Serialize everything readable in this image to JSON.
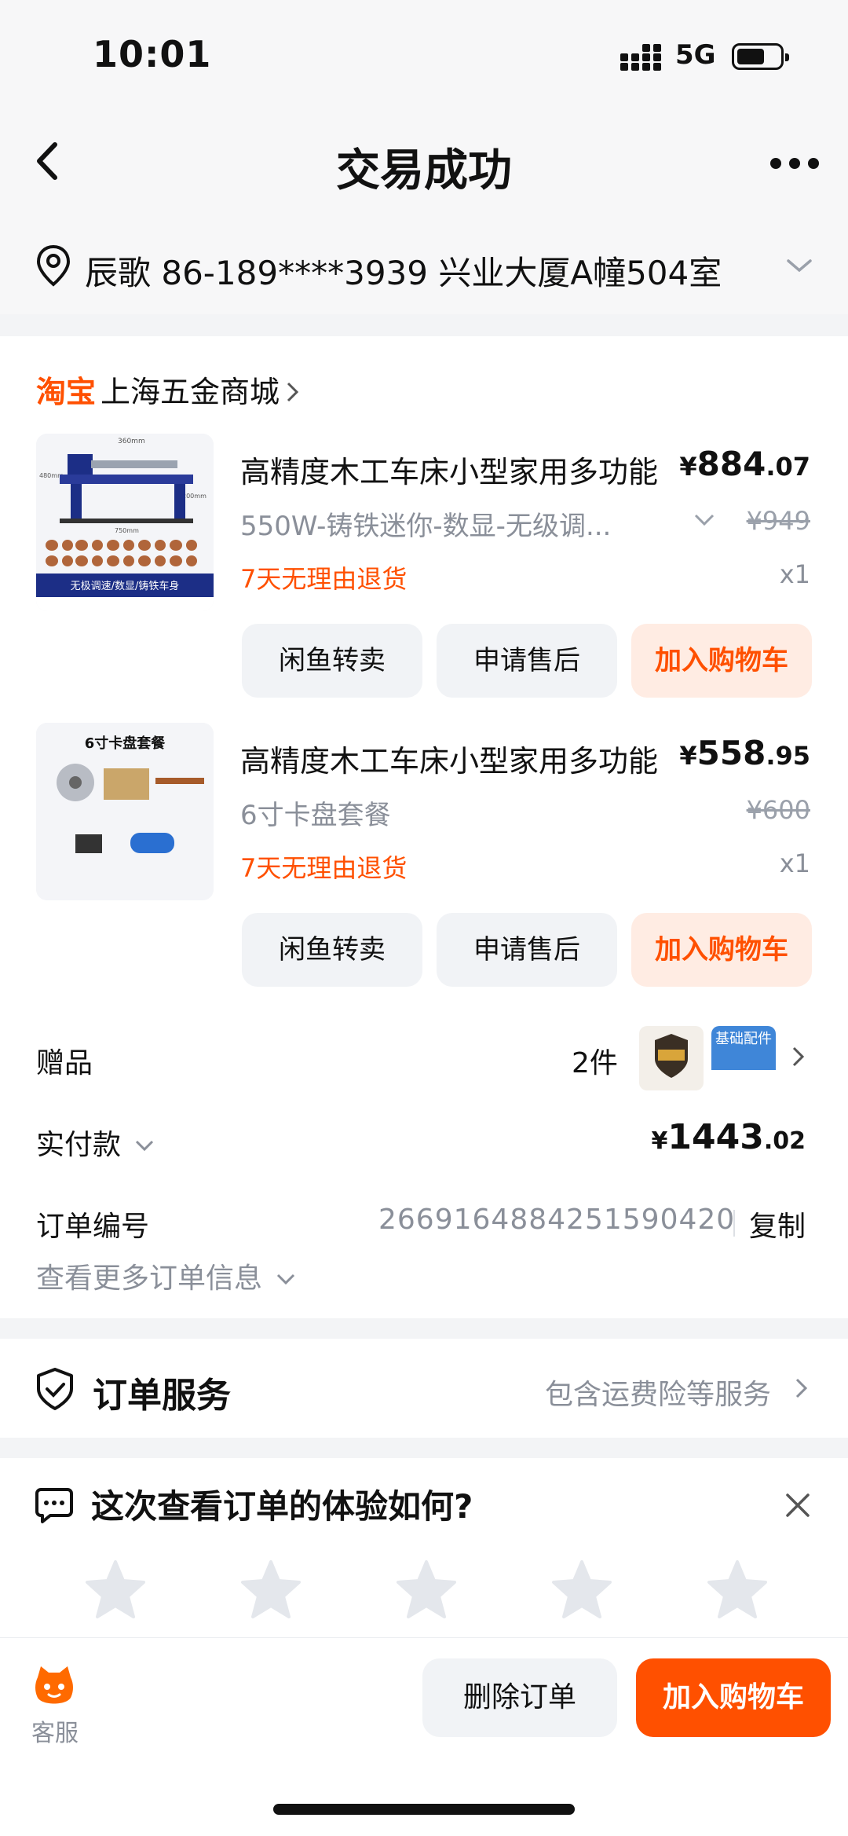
{
  "status_bar": {
    "time": "10:01",
    "network": "5G"
  },
  "nav": {
    "title": "交易成功"
  },
  "address": {
    "text": "辰歌  86-189****3939  兴业大厦A幢504室"
  },
  "shop": {
    "brand": "淘宝",
    "name": "上海五金商城"
  },
  "items": [
    {
      "title": "高精度木工车床小型家用多功能",
      "price_symbol": "¥",
      "price_int": "884",
      "price_dec": ".07",
      "sku": "550W-铸铁迷你-数显-无级调...",
      "original_price": "¥949",
      "refund": "7天无理由退货",
      "qty": "x1",
      "buttons": [
        "闲鱼转卖",
        "申请售后",
        "加入购物车"
      ]
    },
    {
      "title": "高精度木工车床小型家用多功能",
      "price_symbol": "¥",
      "price_int": "558",
      "price_dec": ".95",
      "sku": "6寸卡盘套餐",
      "original_price": "¥600",
      "refund": "7天无理由退货",
      "qty": "x1",
      "buttons": [
        "闲鱼转卖",
        "申请售后",
        "加入购物车"
      ]
    }
  ],
  "thumb1": {
    "top_dim": "360mm",
    "side_dim": "480mm",
    "right_dim": "200mm",
    "bottom_dim": "750mm",
    "banner": "无极调速/数显/铸铁车身"
  },
  "thumb2": {
    "title": "6寸卡盘套餐"
  },
  "gifts": {
    "label": "赠品",
    "count": "2件",
    "gift2_text": "基础配件"
  },
  "payment": {
    "label": "实付款",
    "symbol": "¥",
    "int": "1443",
    "dec": ".02"
  },
  "order": {
    "label": "订单编号",
    "number": "2669164884251590420",
    "copy": "复制",
    "more": "查看更多订单信息"
  },
  "service": {
    "title": "订单服务",
    "desc": "包含运费险等服务"
  },
  "feedback": {
    "title": "这次查看订单的体验如何?"
  },
  "bottom": {
    "kefu": "客服",
    "delete": "删除订单",
    "add_cart": "加入购物车"
  },
  "colors": {
    "accent": "#ff5000",
    "muted": "#8a8f99",
    "button_bg": "#f1f3f6"
  }
}
